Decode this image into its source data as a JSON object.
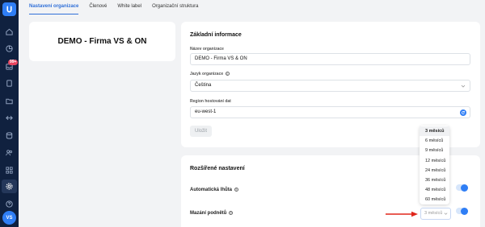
{
  "sidebar": {
    "logo_letter": "U",
    "badge": "99+",
    "avatar": "VS",
    "icons": [
      "home-icon",
      "chart-icon",
      "inbox-icon",
      "document-icon",
      "folder-icon",
      "arrows-icon",
      "database-icon",
      "people-icon",
      "grid-icon",
      "settings-icon",
      "help-icon"
    ]
  },
  "tabs": [
    {
      "label": "Nastavení organizace"
    },
    {
      "label": "Členové"
    },
    {
      "label": "White label"
    },
    {
      "label": "Organizační struktura"
    }
  ],
  "org_card": {
    "name": "DEMO - Firma VS & ON"
  },
  "basic": {
    "title": "Základní informace",
    "name_label": "Název organizace",
    "name_value": "DEMO - Firma VS & ON",
    "lang_label": "Jazyk organizace",
    "lang_value": "Čeština",
    "region_label": "Region hostování dat",
    "region_value": "eu-west-1",
    "save_label": "Uložit"
  },
  "advanced": {
    "title": "Rozšířené nastavení",
    "auto_deadline_label": "Automatická lhůta",
    "delete_label": "Mazání podnětů",
    "select_value": "3 měsíců"
  },
  "dropdown": {
    "options": [
      "3 měsíců",
      "6 měsíců",
      "9 měsíců",
      "12 měsíců",
      "24 měsíců",
      "36 měsíců",
      "48 měsíců",
      "60 měsíců"
    ],
    "selected_index": 0
  },
  "colors": {
    "accent": "#2f7ef5",
    "sidebar": "#10213f",
    "arrow": "#e0261b"
  }
}
